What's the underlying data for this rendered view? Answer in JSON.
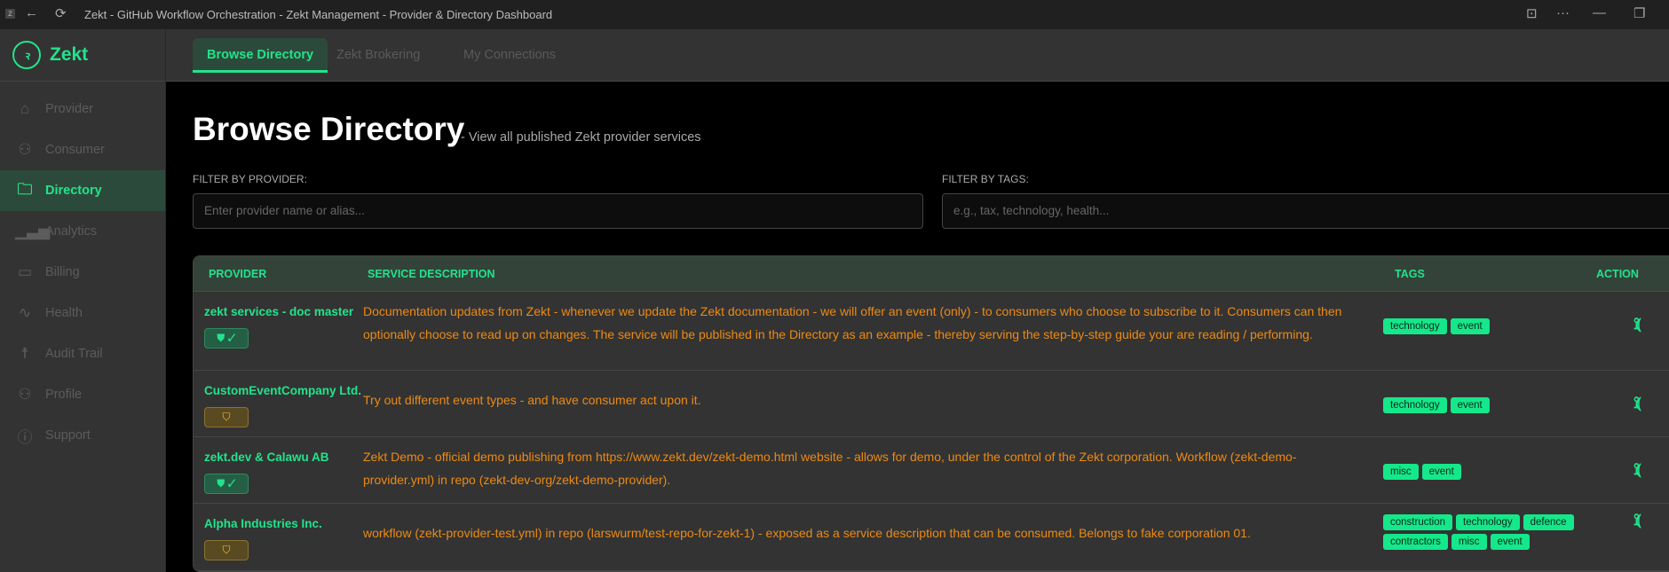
{
  "window": {
    "title": "Zekt - GitHub Workflow Orchestration - Zekt Management - Provider & Directory Dashboard"
  },
  "brand": {
    "name": "Zekt",
    "accent": "#22e38c",
    "description_color": "#ec8a14"
  },
  "sidebar": {
    "items": [
      {
        "label": "Provider",
        "icon": "home-icon"
      },
      {
        "label": "Consumer",
        "icon": "user-icon"
      },
      {
        "label": "Directory",
        "icon": "folder-icon",
        "active": true
      },
      {
        "label": "Analytics",
        "icon": "bar-chart-icon"
      },
      {
        "label": "Billing",
        "icon": "credit-card-icon"
      },
      {
        "label": "Health",
        "icon": "pulse-icon"
      },
      {
        "label": "Audit Trail",
        "icon": "person-icon"
      },
      {
        "label": "Profile",
        "icon": "user-icon"
      },
      {
        "label": "Support",
        "icon": "help-icon"
      }
    ]
  },
  "tabs": [
    {
      "label": "Browse Directory",
      "active": true
    },
    {
      "label": "Zekt Brokering"
    },
    {
      "label": "My Connections"
    }
  ],
  "page": {
    "title": "Browse Directory",
    "subtitle": "- View all published Zekt provider services"
  },
  "filters": {
    "provider": {
      "label": "FILTER BY PROVIDER:",
      "placeholder": "Enter provider name or alias...",
      "value": ""
    },
    "tags": {
      "label": "FILTER BY TAGS:",
      "placeholder": "e.g., tax, technology, health...",
      "value": ""
    }
  },
  "table": {
    "headers": [
      "PROVIDER",
      "SERVICE DESCRIPTION",
      "TAGS",
      "ACTION"
    ],
    "rows": [
      {
        "provider": "zekt services - doc master",
        "verified": true,
        "badge": "shield-check",
        "description": "Documentation updates from Zekt - whenever we update the Zekt documentation - we will offer an event (only) - to consumers who choose to subscribe to it. Consumers can then optionally choose to read up on changes. The service will be published in the Directory as an example - thereby serving the step-by-step guide your are reading / performing.",
        "tags": [
          "technology",
          "event"
        ]
      },
      {
        "provider": "CustomEventCompany Ltd.",
        "verified": false,
        "badge": "shield-warning",
        "description": "Try out different event types - and have consumer act upon it.",
        "tags": [
          "technology",
          "event"
        ]
      },
      {
        "provider": "zekt.dev & Calawu AB",
        "verified": true,
        "badge": "shield-check",
        "description": "Zekt Demo - official demo publishing from https://www.zekt.dev/zekt-demo.html website - allows for demo, under the control of the Zekt corporation. Workflow (zekt-demo-provider.yml) in repo (zekt-dev-org/zekt-demo-provider).",
        "tags": [
          "misc",
          "event"
        ]
      },
      {
        "provider": "Alpha Industries Inc.",
        "verified": false,
        "badge": "shield-warning",
        "description": "workflow (zekt-provider-test.yml) in repo (larswurm/test-repo-for-zekt-1) - exposed as a service description that can be consumed. Belongs to fake corporation 01.",
        "tags": [
          "construction",
          "technology",
          "defence",
          "contractors",
          "misc",
          "event"
        ]
      }
    ]
  }
}
